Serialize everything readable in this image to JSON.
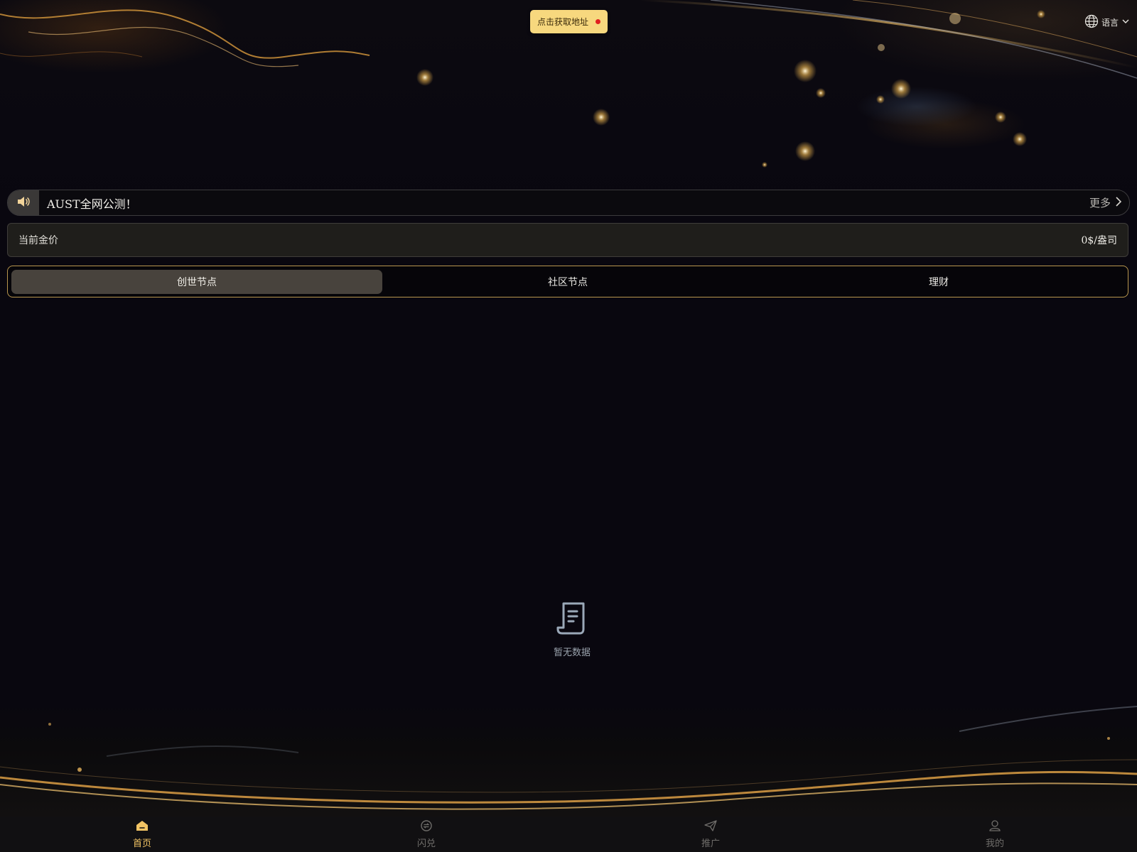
{
  "header": {
    "address_button_label": "点击获取地址",
    "language_label": "语言",
    "icons": {
      "language": "globe-icon",
      "dropdown": "chevron-down-icon",
      "status_dot": "red-dot"
    }
  },
  "notice": {
    "text": "AUST全网公测！",
    "more_label": "更多",
    "icon": "speaker-icon"
  },
  "price": {
    "label": "当前金价",
    "value": "0$/盎司"
  },
  "tabs": [
    {
      "label": "创世节点",
      "active": true
    },
    {
      "label": "社区节点",
      "active": false
    },
    {
      "label": "理财",
      "active": false
    }
  ],
  "empty_state": {
    "text": "暂无数据",
    "icon": "document-icon"
  },
  "bottom_nav": [
    {
      "label": "首页",
      "icon": "home-icon",
      "active": true
    },
    {
      "label": "闪兑",
      "icon": "exchange-icon",
      "active": false
    },
    {
      "label": "推广",
      "icon": "paper-plane-icon",
      "active": false
    },
    {
      "label": "我的",
      "icon": "user-icon",
      "active": false
    }
  ],
  "colors": {
    "accent_gold": "#f2c464",
    "button_gold": "#f7d87e",
    "tab_border": "#b8964e",
    "background": "#09070f"
  }
}
